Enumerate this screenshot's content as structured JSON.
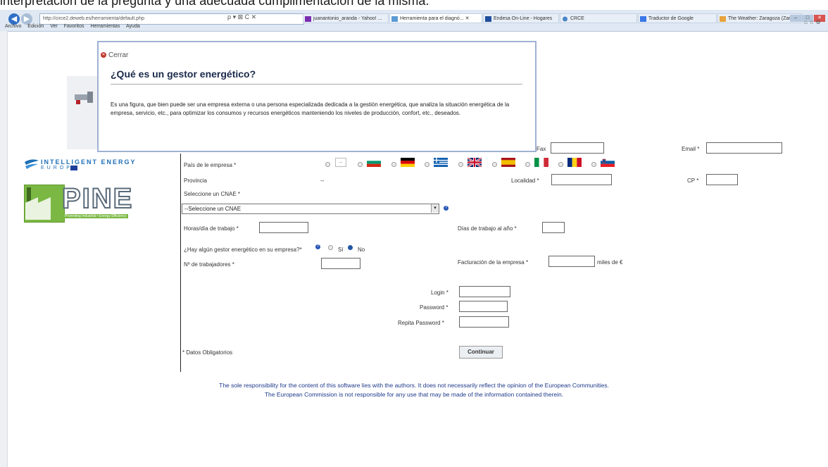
{
  "caption": "interpretación de la pregunta y una adecuada cumplimentación de la misma.",
  "browser": {
    "address": "http://circe2.deweb.es/herramienta/default.php",
    "address_controls": "ρ ▾ ⊠ C ✕",
    "tabs": [
      {
        "label": "juanantonio_aranda - Yahoo! ...",
        "active": false
      },
      {
        "label": "Herramienta para el diagnó... ✕",
        "active": true
      },
      {
        "label": "Endesa On-Line - Hogares",
        "active": false
      },
      {
        "label": "CRCE",
        "active": false
      },
      {
        "label": "Traductor de Google",
        "active": false
      },
      {
        "label": "The Weather: Zaragoza (Zarag...",
        "active": false
      }
    ],
    "menu": [
      "Archivo",
      "Edición",
      "Ver",
      "Favoritos",
      "Herramientas",
      "Ayuda"
    ]
  },
  "modal": {
    "close_label": "Cerrar",
    "title": "¿Qué es un gestor energético?",
    "body": "Es una figura, que bien puede ser una empresa externa o una persona especializada dedicada a la gestión energética, que analiza la situación energética de la empresa, servicio, etc., para optimizar los consumos y recursos energéticos manteniendo los niveles de producción, confort, etc., deseados."
  },
  "logos": {
    "ie_title": "INTELLIGENT ENERGY",
    "ie_sub": "EUROPE",
    "pine_title": "PINE",
    "pine_tagline": "Promoting Industrial • Energy Efficiency"
  },
  "form": {
    "fax_label": "Fax",
    "email_label": "Email *",
    "country_label": "País de le empresa *",
    "province_label": "Provincia",
    "province_value": "--",
    "locality_label": "Localidad *",
    "cp_label": "CP *",
    "cnae_label": "Seleccione un CNAE *",
    "cnae_selected": "--Seleccione un CNAE",
    "hours_label": "Horas/día de trabajo *",
    "days_label": "Días de trabajo al año *",
    "manager_question": "¿Hay algún gestor energético en su empresa?*",
    "manager_yes": "Sí",
    "manager_no": "No",
    "manager_selected": "No",
    "workers_label": "Nº de trabajadores *",
    "revenue_label": "Facturación de la empresa *",
    "revenue_unit": "miles de €",
    "login_label": "Login *",
    "password_label": "Password *",
    "repeat_password_label": "Repita Password *",
    "required_note": "* Datos Obligatorios",
    "submit_label": "Continuar",
    "country_flags": [
      "bulgaria-flag",
      "germany-flag",
      "greece-flag",
      "uk-flag",
      "spain-flag",
      "italy-flag",
      "romania-flag",
      "slovenia-flag"
    ]
  },
  "footer": {
    "line1": "The sole responsibility for the content of this software lies with the authors. It does not necessarily reflect the opinion of the European Communities.",
    "line2": "The European Commission is not responsible for any use that may be made of the information contained therein."
  }
}
